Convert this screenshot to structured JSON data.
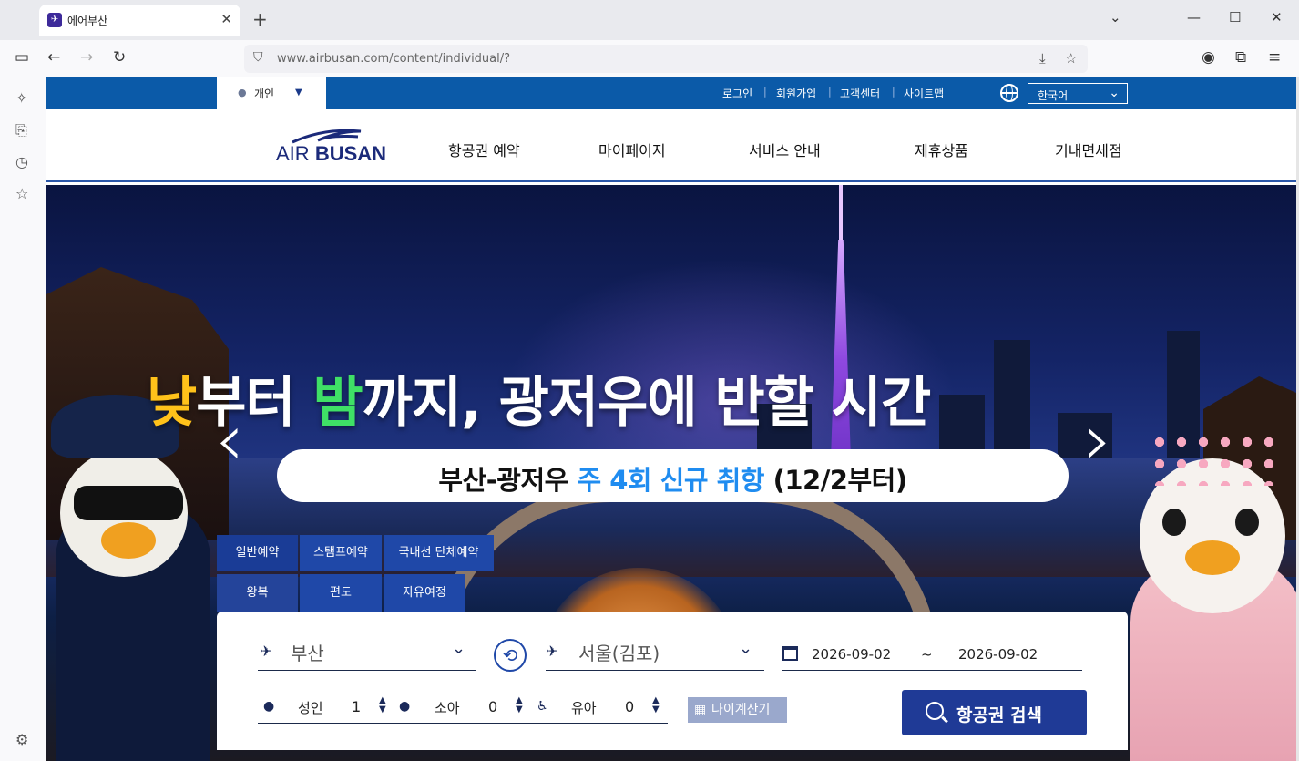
{
  "browser": {
    "tab_title": "에어부산",
    "url": "www.airbusan.com/content/individual/?",
    "new_tab_symbol": "+",
    "close_symbol": "✕"
  },
  "util": {
    "persona": "개인",
    "links": [
      "로그인",
      "회원가입",
      "고객센터",
      "사이트맵"
    ],
    "language": "한국어"
  },
  "header": {
    "logo_air": "AIR",
    "logo_busan": "BUSAN",
    "nav": [
      "항공권 예약",
      "마이페이지",
      "서비스 안내",
      "제휴상품",
      "기내면세점"
    ]
  },
  "hero": {
    "headline_part1": "낮",
    "headline_part2": "부터 ",
    "headline_part3": "밤",
    "headline_part4": "까지, 광저우에 반할 시간",
    "sub_part1": "부산-광저우 ",
    "sub_part2": "주 4회 신규 취항",
    "sub_part3": " (12/2부터)",
    "prev": "‹",
    "next": "›"
  },
  "booking": {
    "type_tabs": [
      "일반예약",
      "스탬프예약",
      "국내선 단체예약"
    ],
    "trip_tabs": [
      "왕복",
      "편도",
      "자유여정"
    ],
    "origin": "부산",
    "destination": "서울(김포)",
    "depart_date": "2026-09-02",
    "date_sep": "~",
    "return_date": "2026-09-02",
    "pax": [
      {
        "label": "성인",
        "value": "1"
      },
      {
        "label": "소아",
        "value": "0"
      },
      {
        "label": "유아",
        "value": "0"
      }
    ],
    "age_calc": "나이계산기",
    "search": "항공권 검색"
  },
  "colors": {
    "brand_blue": "#0b5aa8",
    "panel_blue": "#1f48a8",
    "highlight_yellow": "#ffc21a",
    "highlight_green": "#3fe066",
    "highlight_blue": "#1f8cf0"
  }
}
